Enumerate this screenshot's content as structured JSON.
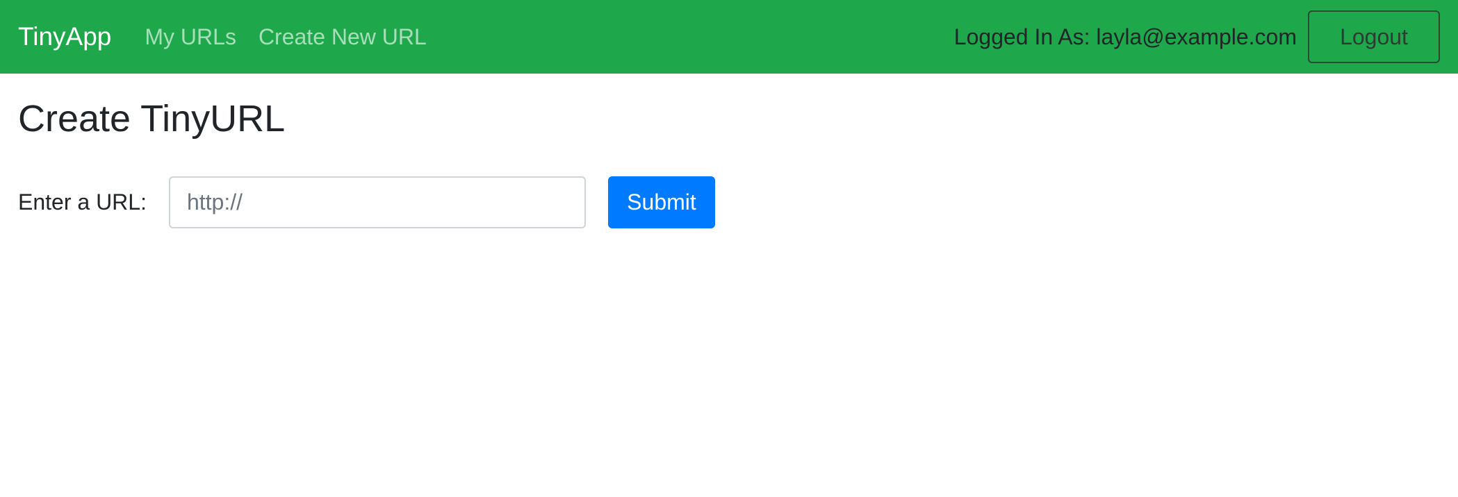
{
  "navbar": {
    "brand": "TinyApp",
    "links": [
      {
        "label": "My URLs"
      },
      {
        "label": "Create New URL"
      }
    ],
    "logged_in_text": "Logged In As: layla@example.com",
    "logout_label": "Logout",
    "bg_color": "#1fa84b"
  },
  "main": {
    "title": "Create TinyURL",
    "form": {
      "label": "Enter a URL:",
      "input_placeholder": "http://",
      "input_value": "",
      "submit_label": "Submit"
    },
    "submit_color": "#007bff"
  }
}
